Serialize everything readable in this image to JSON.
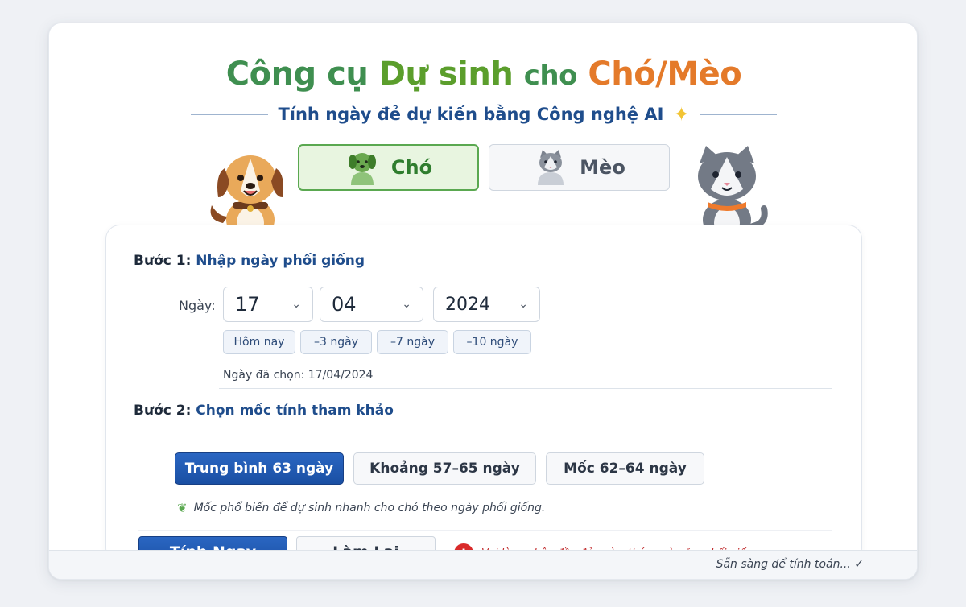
{
  "header": {
    "title_part1": "Công cụ",
    "title_part2": "Dự sinh",
    "title_part3": "cho",
    "title_part4": "Chó/Mèo",
    "subtitle": "Tính ngày đẻ dự kiến bằng Công nghệ AI"
  },
  "pet_tabs": [
    {
      "label": "Chó",
      "icon": "dog-icon",
      "active": true
    },
    {
      "label": "Mèo",
      "icon": "cat-icon",
      "active": false
    }
  ],
  "step1": {
    "prefix": "Bước 1:",
    "text": "Nhập ngày phối giống",
    "date_label": "Ngày:",
    "day": "17",
    "month": "04",
    "year": "2024",
    "quick_buttons": [
      "Hôm nay",
      "–3 ngày",
      "–7 ngày",
      "–10 ngày"
    ],
    "chosen": "Ngày đã chọn: 17/04/2024"
  },
  "step2": {
    "prefix": "Bước 2:",
    "text": "Chọn mốc tính tham khảo",
    "options": [
      "Trung bình 63 ngày",
      "Khoảng 57–65 ngày",
      "Mốc 62–64 ngày"
    ],
    "selected_index": 0,
    "hint": "Mốc phổ biến để dự sinh nhanh cho chó theo ngày phối giống."
  },
  "actions": {
    "calculate": "Tính Ngay",
    "reset": "Làm Lại",
    "error": "Vui lòng nhập đầy đủ ngày, tháng và năm phối giống."
  },
  "status": {
    "text": "Sẵn sàng để tính toán... ✓"
  },
  "colors": {
    "primary": "#1f4d8c",
    "accent_green": "#5aa850",
    "accent_orange": "#e47a2a",
    "error": "#d92a2a"
  }
}
